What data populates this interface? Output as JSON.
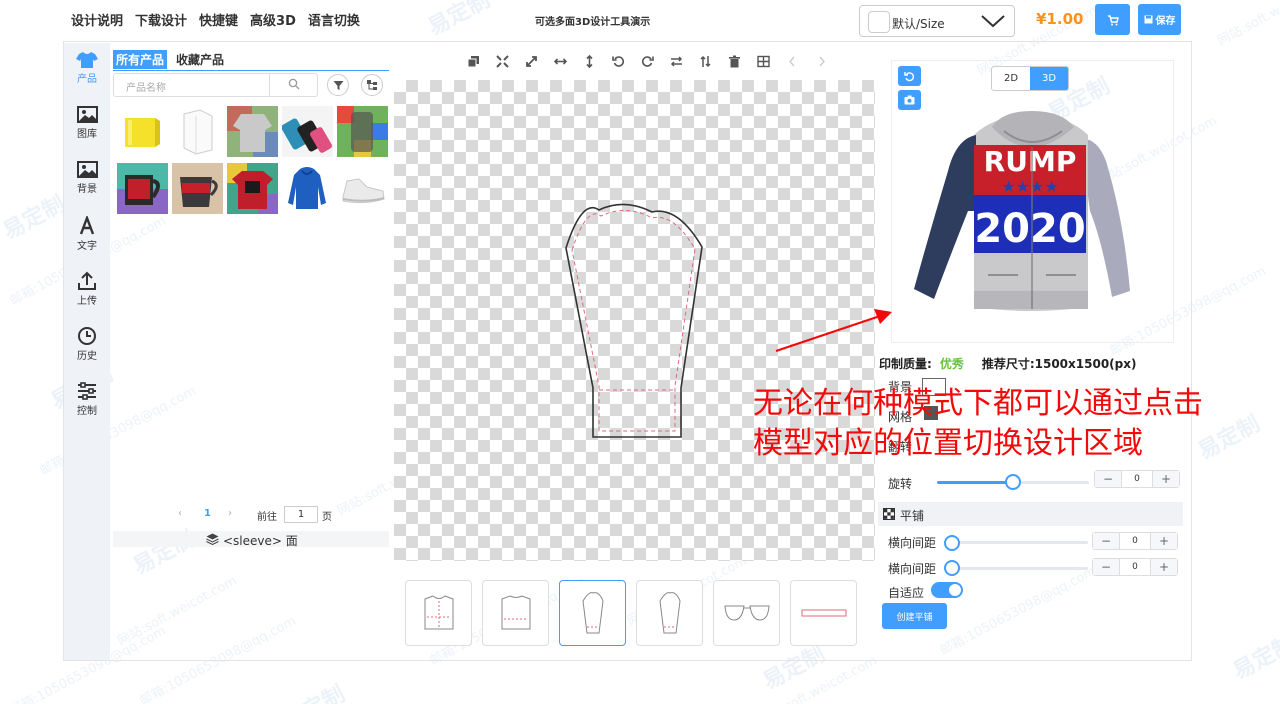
{
  "topbar": {
    "menu": [
      "设计说明",
      "下载设计",
      "快捷键",
      "高级3D",
      "语言切换"
    ],
    "title": "可选多面3D设计工具演示",
    "size_select": "默认/Size",
    "price": "¥1.00",
    "save_label": "保存"
  },
  "leftnav": [
    {
      "label": "产品",
      "icon": "shirt-icon",
      "active": true
    },
    {
      "label": "图库",
      "icon": "image-icon"
    },
    {
      "label": "背景",
      "icon": "background-image-icon"
    },
    {
      "label": "文字",
      "icon": "text-icon"
    },
    {
      "label": "上传",
      "icon": "upload-icon"
    },
    {
      "label": "历史",
      "icon": "clock-icon"
    },
    {
      "label": "控制",
      "icon": "sliders-icon"
    }
  ],
  "products": {
    "tabs": [
      "所有产品",
      "收藏产品"
    ],
    "search_placeholder": "产品名称",
    "pager": {
      "page": "1",
      "goto_label": "前往",
      "goto_value": "1",
      "page_unit": "页"
    },
    "layer_label": "<sleeve> 面"
  },
  "right": {
    "mode_2d": "2D",
    "mode_3d": "3D",
    "hoodie_text_top": "RUMP",
    "hoodie_text_bottom": "2020",
    "quality_label": "印制质量:",
    "quality_value": "优秀",
    "recommend_label": "推荐尺寸:1500x1500(px)",
    "rows": [
      "背景",
      "网格",
      "翻转"
    ],
    "rotate_label": "旋转",
    "rotate_value": "0",
    "tile_header": "平铺",
    "h_spacing_label": "横向间距",
    "h_spacing_value": "0",
    "v_spacing_label": "横向间距",
    "v_spacing_value": "0",
    "adaptive_label": "自适应",
    "create_tile_label": "创建平铺"
  },
  "annotation": {
    "line1": "无论在何种模式下都可以通过点击",
    "line2": "模型对应的位置切换设计区域"
  },
  "watermark": {
    "brand": "易定制",
    "site": "网站:soft.weicot.com",
    "mail": "邮箱:1050653098@qq.com"
  },
  "colors": {
    "accent": "#409eff",
    "price": "#f7931e",
    "annotation": "#f20a0a",
    "quality_good": "#67c23a"
  }
}
